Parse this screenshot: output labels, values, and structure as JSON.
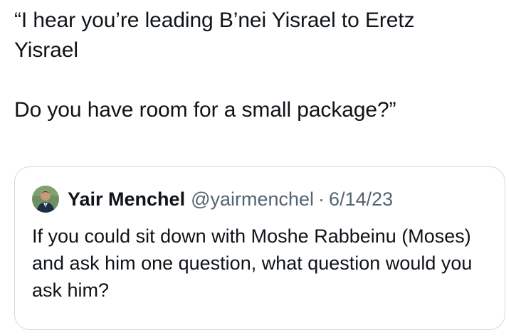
{
  "tweet": {
    "text": "“I hear you’re leading B’nei Yisrael to Eretz\nYisrael\n\nDo you have room for a small package?”"
  },
  "quoted_tweet": {
    "author_name": "Yair Menchel",
    "author_handle": "@yairmenchel",
    "separator": "·",
    "date": "6/14/23",
    "text": "If you could sit down with Moshe Rabbeinu (Moses) and ask him one question, what question would you ask him?"
  }
}
